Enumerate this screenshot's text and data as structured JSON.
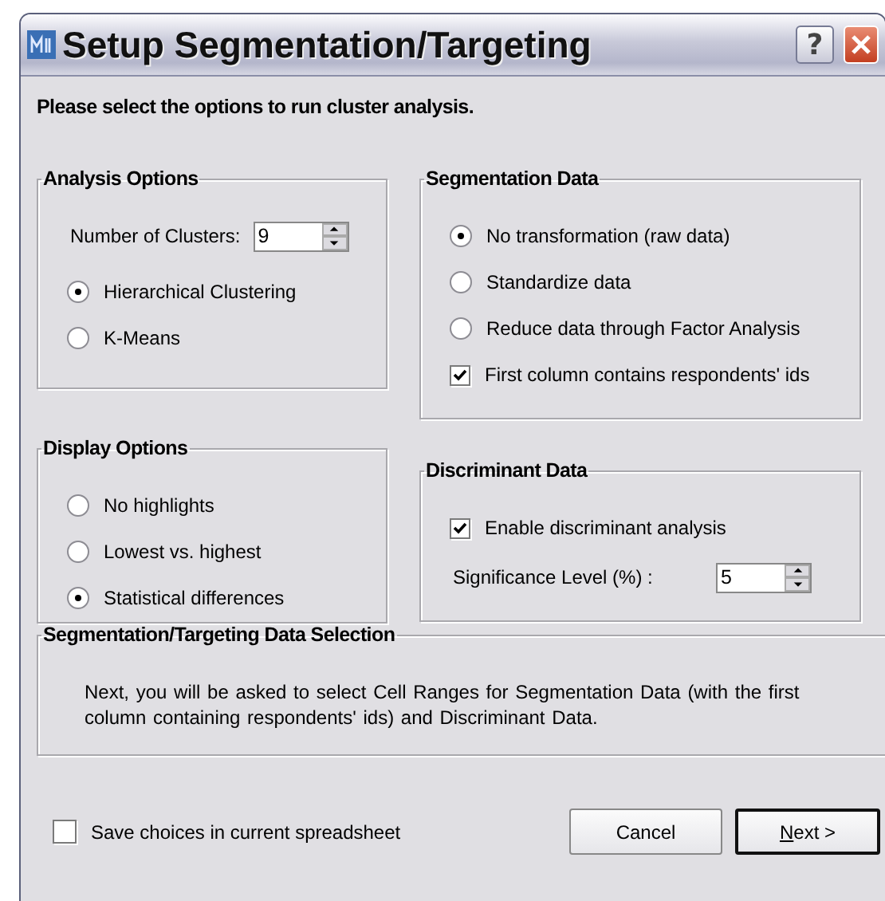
{
  "window": {
    "title": "Setup Segmentation/Targeting",
    "help": "?"
  },
  "instruction": "Please select the options to run cluster analysis.",
  "left_column": [
    {
      "title": "Analysis Options",
      "items": [
        {
          "kind": "spinner",
          "label": "Number of Clusters:",
          "value": "9"
        },
        {
          "kind": "radio",
          "label": "Hierarchical Clustering",
          "selected": true
        },
        {
          "kind": "radio",
          "label": "K-Means",
          "selected": false
        }
      ]
    },
    {
      "title": "Display Options",
      "items": [
        {
          "kind": "radio",
          "label": "No highlights",
          "selected": false
        },
        {
          "kind": "radio",
          "label": "Lowest vs. highest",
          "selected": false
        },
        {
          "kind": "radio",
          "label": "Statistical differences",
          "selected": true
        }
      ]
    }
  ],
  "right_column": [
    {
      "title": "Segmentation Data",
      "items": [
        {
          "kind": "radio",
          "label": "No transformation (raw data)",
          "selected": true
        },
        {
          "kind": "radio",
          "label": "Standardize data",
          "selected": false
        },
        {
          "kind": "radio",
          "label": "Reduce data through Factor Analysis",
          "selected": false
        },
        {
          "kind": "checkbox",
          "label": "First column contains respondents' ids",
          "checked": true
        }
      ]
    },
    {
      "title": "Discriminant Data",
      "items": [
        {
          "kind": "checkbox",
          "label": "Enable discriminant analysis",
          "checked": true
        },
        {
          "kind": "spinner",
          "label": "Significance Level (%) :",
          "value": "5"
        }
      ]
    }
  ],
  "bottom_group": {
    "title": "Segmentation/Targeting Data Selection",
    "items": [
      {
        "kind": "text",
        "label": "Next, you will be asked to select Cell Ranges for Segmentation Data (with the first column containing respondents' ids) and Discriminant Data."
      }
    ]
  },
  "save_checkbox": {
    "label": "Save choices in current spreadsheet",
    "checked": false
  },
  "buttons": [
    {
      "label": "Cancel",
      "default": false,
      "mnemonic_underlined": false
    },
    {
      "label": "Next >",
      "default": true,
      "mnemonic_underlined": true
    }
  ]
}
